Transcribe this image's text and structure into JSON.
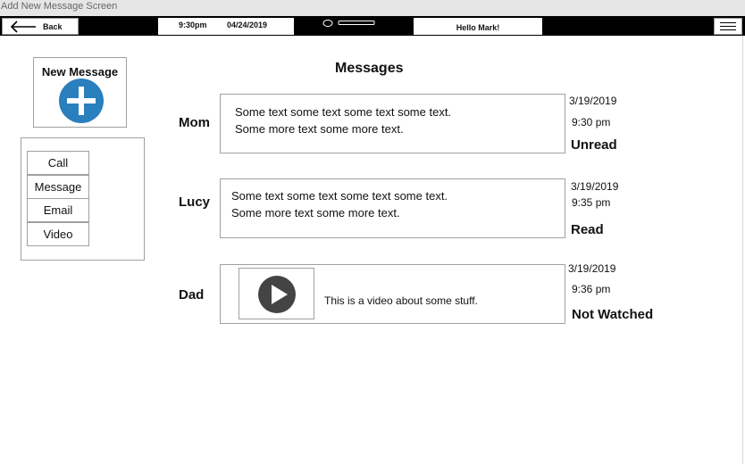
{
  "window": {
    "title": "Add New Message Screen"
  },
  "topbar": {
    "back_label": "Back",
    "time": "9:30pm",
    "date": "04/24/2019",
    "greeting": "Hello Mark!"
  },
  "sidebar": {
    "new_message_label": "New Message",
    "actions": [
      "Call",
      "Message",
      "Email",
      "Video"
    ]
  },
  "main": {
    "heading": "Messages",
    "messages": [
      {
        "sender": "Mom",
        "line1": "Some text some text some text some text.",
        "line2": "Some more text some more text.",
        "date": "3/19/2019",
        "time": "9:30 pm",
        "status": "Unread"
      },
      {
        "sender": "Lucy",
        "line1": "Some text some text some text some text.",
        "line2": "Some more text some more text.",
        "date": "3/19/2019",
        "time": "9:35 pm",
        "status": "Read"
      },
      {
        "sender": "Dad",
        "video_caption": "This is a video about some stuff.",
        "date": "3/19/2019",
        "time": "9:36 pm",
        "status": "Not Watched"
      }
    ]
  },
  "colors": {
    "accent": "#2a7fbd",
    "play_button": "#444444",
    "topbar": "#000000"
  }
}
